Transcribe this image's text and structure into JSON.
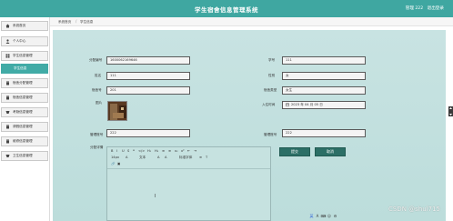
{
  "header": {
    "title": "学生宿舍信息管理系统",
    "user_label": "管理 222",
    "logout_label": "退出登录"
  },
  "sidebar": {
    "items": [
      {
        "label": "系统首页",
        "icon": "home-icon"
      },
      {
        "label": "个人中心",
        "icon": "person-icon"
      },
      {
        "label": "学生信息管理",
        "icon": "grid-icon"
      },
      {
        "label": "学生信息",
        "icon": ""
      },
      {
        "label": "宿舍分配管理",
        "icon": "building-icon"
      },
      {
        "label": "宿舍信息管理",
        "icon": "building-icon"
      },
      {
        "label": "考勤信息管理",
        "icon": "clipboard-icon"
      },
      {
        "label": "请假信息管理",
        "icon": "building-icon"
      },
      {
        "label": "维修信息管理",
        "icon": "building-icon"
      },
      {
        "label": "卫生信息管理",
        "icon": "clipboard-icon"
      }
    ]
  },
  "breadcrumb": {
    "home": "系统首页",
    "current": "学生信息"
  },
  "form": {
    "student_id_label": "分配编号",
    "student_id_value": "1600062169646",
    "xuehao_label": "学号",
    "xuehao_value": "111",
    "name_label": "姓名",
    "name_value": "111",
    "sex_label": "性别",
    "sex_value": "女",
    "dorm_label": "宿舍号",
    "dorm_value": "201",
    "dorm_type_label": "宿舍类型",
    "dorm_type_value": "女生",
    "photo_label": "图片",
    "date_label": "入住时间",
    "date_value": "2023 年 04 月 05 日",
    "manager_id_label": "管理账号",
    "manager_id_value": "222",
    "manager_name_label": "管理账号",
    "manager_name_value": "222",
    "notes_label": "分配详情",
    "submit_label": "提交",
    "cancel_label": "取消"
  },
  "editor": {
    "toolbar_row1": [
      "B",
      "I",
      "U",
      "S",
      "❝",
      "</>",
      "H₁",
      "H₂",
      "≡",
      "≡",
      "x₂",
      "x²",
      "⇤",
      "⇥"
    ],
    "toolbar_row2": [
      "14px",
      "文本",
      "标准字体"
    ],
    "toolbar_row3": [
      "🔗",
      "▣"
    ]
  },
  "ime": {
    "keys": [
      "英",
      "A",
      "⌨",
      "☺",
      "⚙"
    ]
  },
  "watermark": "CSDN @shul715",
  "colors": {
    "header": "#3fa7a1",
    "sidebar_active": "#41aba6",
    "panel": "#c8e3e2",
    "button": "#2c6f66"
  }
}
